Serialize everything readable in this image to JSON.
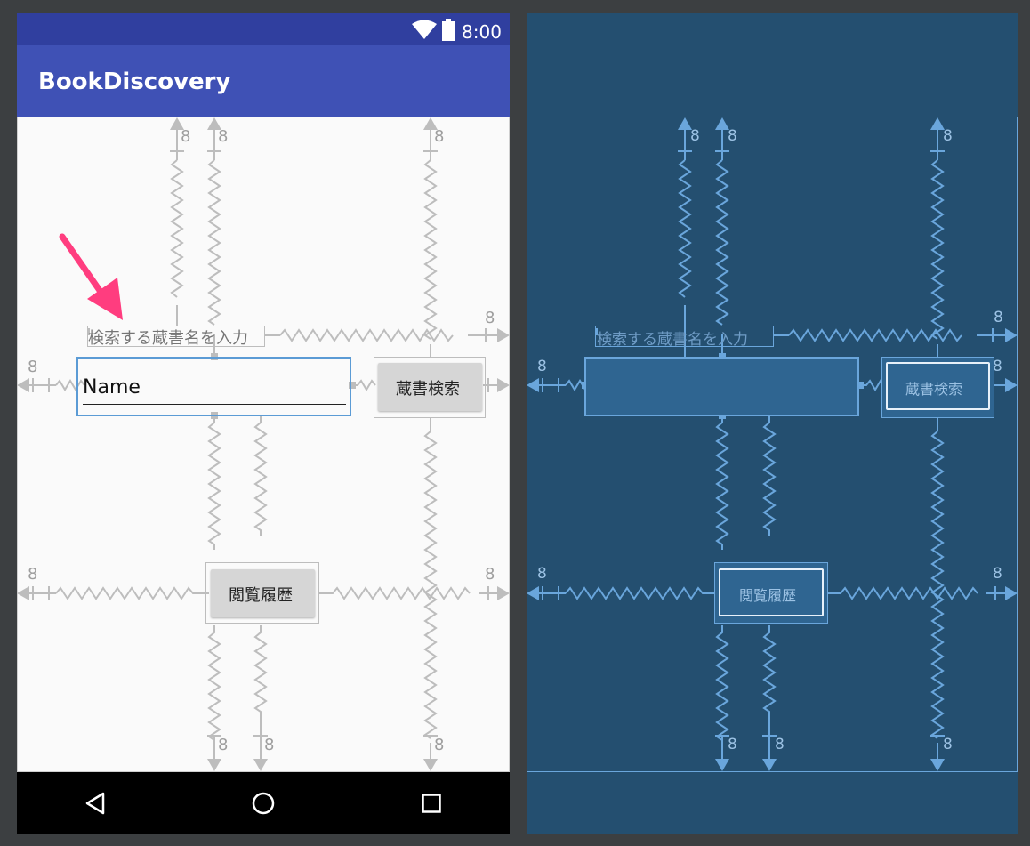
{
  "status_bar": {
    "time": "8:00"
  },
  "app_bar": {
    "title": "BookDiscovery"
  },
  "form": {
    "search_hint": "検索する蔵書名を入力",
    "name_field_value": "Name",
    "search_button_label": "蔵書検索",
    "history_button_label": "閲覧履歴"
  },
  "constraint_margin": "8",
  "colors": {
    "status_bar": "#303f9f",
    "app_bar": "#3f51b5",
    "blueprint_bg": "#244f70",
    "blueprint_line": "#6aa6dc",
    "constraint_gray": "#bdbdbd",
    "annotation_arrow": "#ff3d7f",
    "selection_blue": "#5b9bd5"
  },
  "icons": [
    "wifi-icon",
    "battery-icon",
    "back-icon",
    "home-icon",
    "recents-icon",
    "annotation-arrow-icon"
  ]
}
